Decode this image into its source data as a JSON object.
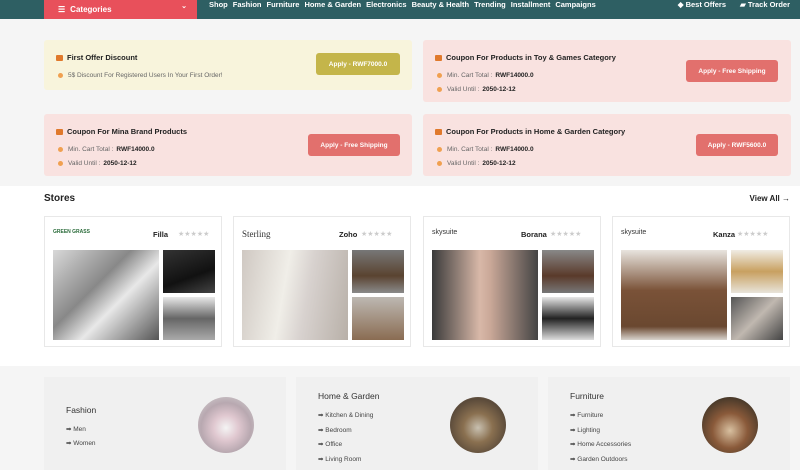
{
  "nav": {
    "categories_label": "Categories",
    "items": [
      "Shop",
      "Fashion",
      "Furniture",
      "Home & Garden",
      "Electronics",
      "Beauty & Health",
      "Trending",
      "Installment",
      "Campaigns"
    ],
    "best_offers": "Best Offers",
    "track_order": "Track Order"
  },
  "coupons": [
    {
      "title": "First Offer Discount",
      "line1": "5$ Discount For Registered Users In Your First Order!",
      "line1_value": "",
      "line2": "",
      "line2_value": "",
      "button": "Apply - RWF7000.0"
    },
    {
      "title": "Coupon For Products in Toy & Games Category",
      "line1": "Min. Cart Total :",
      "line1_value": "RWF14000.0",
      "line2": "Valid Until :",
      "line2_value": "2050-12-12",
      "button": "Apply - Free Shipping"
    },
    {
      "title": "Coupon For Mina Brand Products",
      "line1": "Min. Cart Total :",
      "line1_value": "RWF14000.0",
      "line2": "Valid Until :",
      "line2_value": "2050-12-12",
      "button": "Apply - Free Shipping"
    },
    {
      "title": "Coupon For Products in Home & Garden Category",
      "line1": "Min. Cart Total :",
      "line1_value": "RWF14000.0",
      "line2": "Valid Until :",
      "line2_value": "2050-12-12",
      "button": "Apply - RWF5600.0"
    }
  ],
  "stores": {
    "title": "Stores",
    "view_all": "View All",
    "items": [
      {
        "name": "Filla",
        "logo": "GREEN GRASS"
      },
      {
        "name": "Zoho",
        "logo": "Sterling"
      },
      {
        "name": "Borana",
        "logo": "skysuite"
      },
      {
        "name": "Kanza",
        "logo": "skysuite"
      }
    ],
    "stars": "★★★★★"
  },
  "categories": [
    {
      "title": "Fashion",
      "links": [
        "Men",
        "Women"
      ]
    },
    {
      "title": "Home & Garden",
      "links": [
        "Kitchen & Dining",
        "Bedroom",
        "Office",
        "Living Room"
      ]
    },
    {
      "title": "Furniture",
      "links": [
        "Furniture",
        "Lighting",
        "Home Accessories",
        "Garden Outdoors"
      ]
    }
  ],
  "colors": {
    "accent": "#e8505b",
    "topbar": "#2e5f63"
  }
}
